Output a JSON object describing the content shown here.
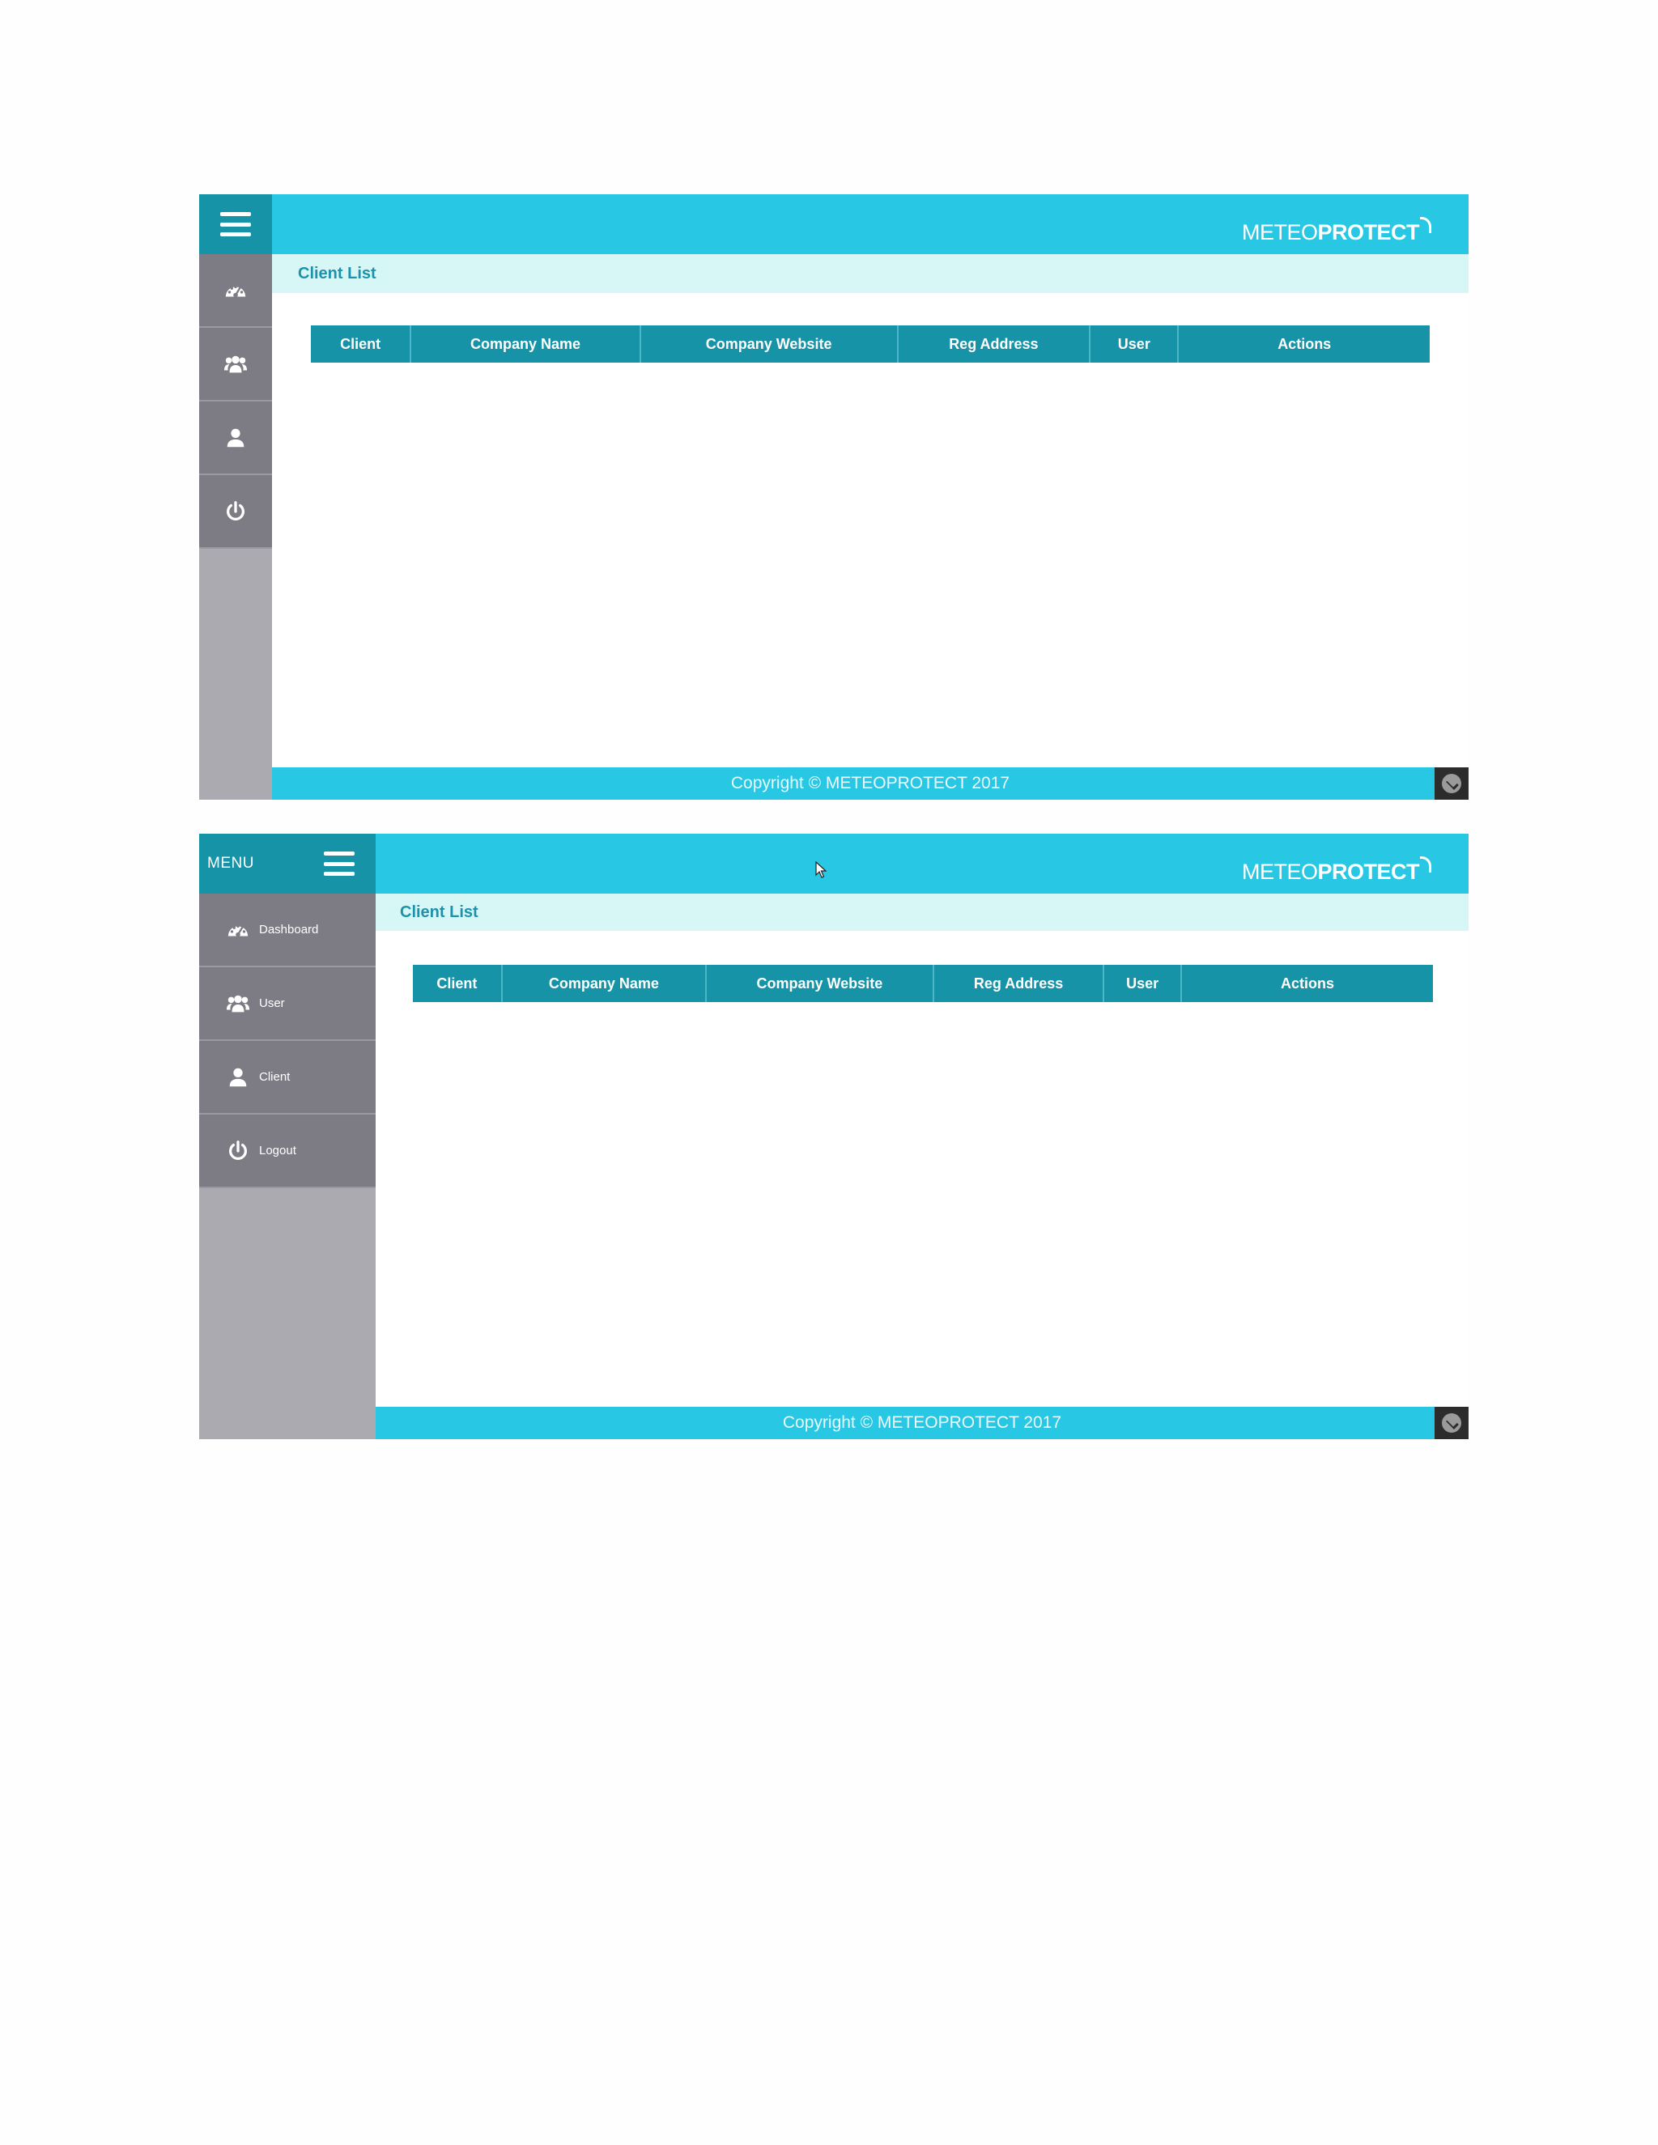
{
  "brand": {
    "thin": "METEO",
    "bold": "PROTECT"
  },
  "page_title": "Client List",
  "table_columns": [
    "Client",
    "Company Name",
    "Company Website",
    "Reg Address",
    "User",
    "Actions"
  ],
  "footer": {
    "copyright": "Copyright © METEOPROTECT 2017"
  },
  "sidebar": {
    "menu_label": "MENU",
    "items": [
      {
        "label": "Dashboard",
        "icon": "dashboard-icon"
      },
      {
        "label": "User",
        "icon": "users-icon"
      },
      {
        "label": "Client",
        "icon": "client-icon"
      },
      {
        "label": "Logout",
        "icon": "power-icon"
      }
    ]
  },
  "colors": {
    "header": "#28c8e4",
    "sidebar_top": "#1793a8",
    "sidebar_item": "#7d7b84",
    "sidebar_bg": "#abaab0",
    "page_bar": "#d7f7f7",
    "table_header": "#1793a8",
    "title_text": "#1d92ab"
  }
}
